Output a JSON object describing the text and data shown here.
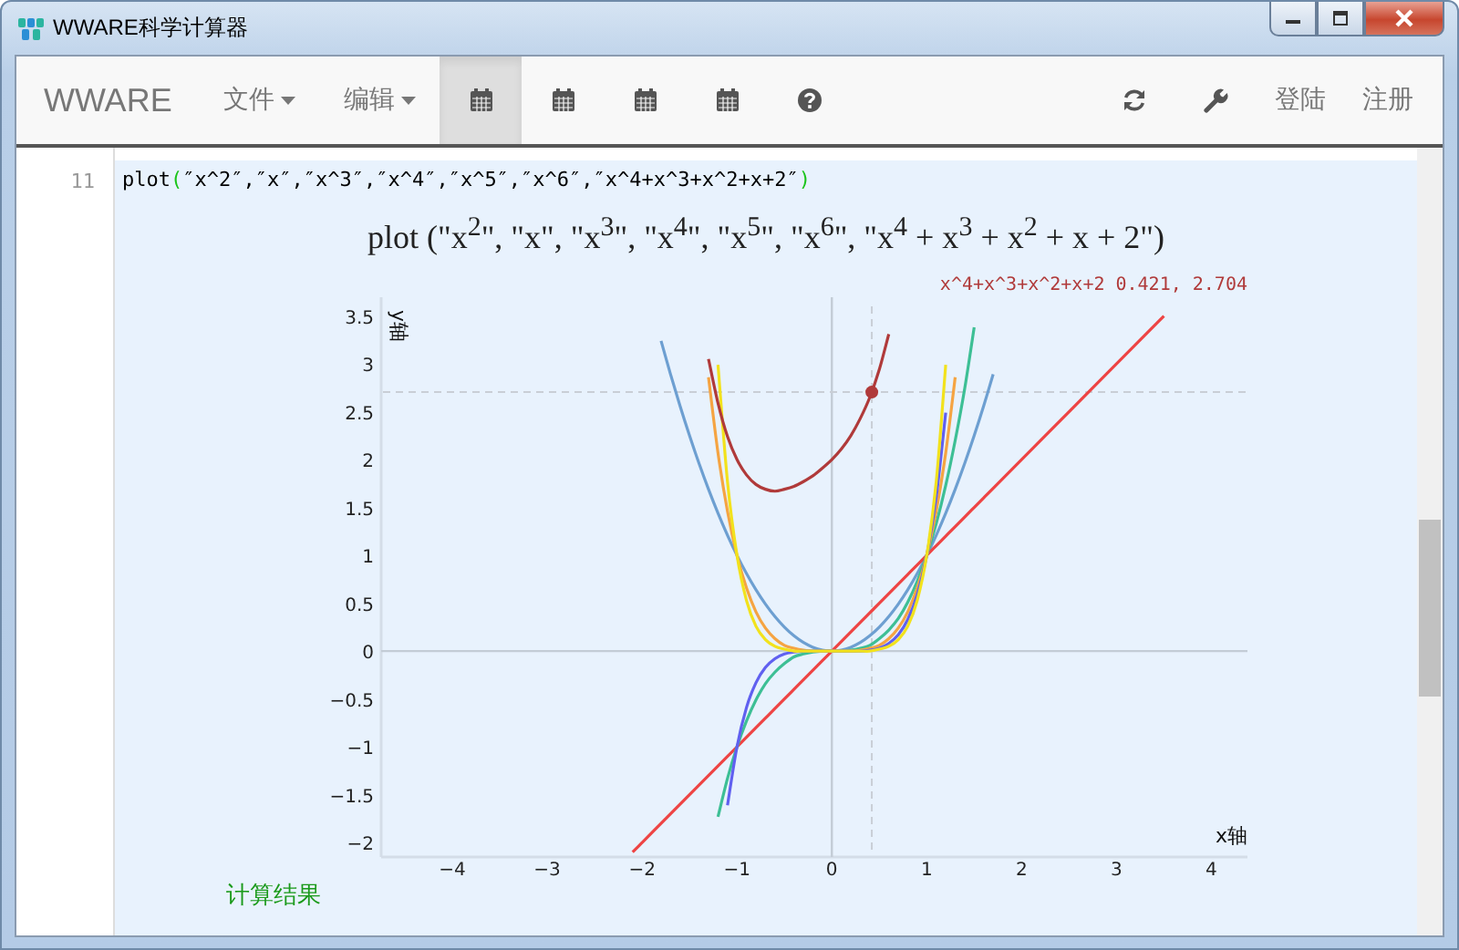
{
  "window": {
    "title": "WWARE科学计算器"
  },
  "navbar": {
    "brand": "WWARE",
    "menus": [
      {
        "label": "文件",
        "dropdown": true
      },
      {
        "label": "编辑",
        "dropdown": true
      }
    ],
    "tools": [
      {
        "kind": "calendar",
        "selected": true
      },
      {
        "kind": "calendar",
        "selected": false
      },
      {
        "kind": "calendar",
        "selected": false
      },
      {
        "kind": "calendar",
        "selected": false
      },
      {
        "kind": "help",
        "selected": false
      }
    ],
    "right_tools": [
      {
        "kind": "refresh"
      },
      {
        "kind": "wrench"
      }
    ],
    "links": [
      "登陆",
      "注册"
    ]
  },
  "editor": {
    "line_number": "11",
    "code": {
      "function": "plot",
      "open": "(",
      "args": "″x^2″,″x″,″x^3″,″x^4″,″x^5″,″x^6″,″x^4+x^3+x^2+x+2″",
      "close": ")"
    },
    "formula": "plot (\"x$^{2}$\", \"x\", \"x$^{3}$\", \"x$^{4}$\", \"x$^{5}$\", \"x$^{6}$\", \"x$^{4}$ + x$^{3}$ + x$^{2}$ + x + 2\")",
    "hover_readout": "x^4+x^3+x^2+x+2 0.421, 2.704",
    "chart_data": {
      "type": "line",
      "xlabel": "x轴",
      "ylabel": "y轴",
      "x": [
        -2.1,
        -2,
        -1.9,
        -1.8,
        -1.7,
        -1.6,
        -1.5,
        -1.4,
        -1.3,
        -1.2,
        -1.1,
        -1,
        -0.9,
        -0.8,
        -0.7,
        -0.6,
        -0.5,
        -0.4,
        -0.3,
        -0.2,
        -0.1,
        0,
        0.1,
        0.2,
        0.3,
        0.4,
        0.5,
        0.6,
        0.7,
        0.8,
        0.9,
        1,
        1.1,
        1.2,
        1.3,
        1.4,
        1.5,
        1.6,
        1.7,
        2.5,
        3.5
      ],
      "series": [
        {
          "color": "#6d9fd1",
          "values": [
            null,
            null,
            null,
            3.24,
            2.89,
            2.56,
            2.25,
            1.96,
            1.69,
            1.44,
            1.21,
            1,
            0.81,
            0.64,
            0.49,
            0.36,
            0.25,
            0.16,
            0.09,
            0.04,
            0.01,
            0,
            0.01,
            0.04,
            0.09,
            0.16,
            0.25,
            0.36,
            0.49,
            0.64,
            0.81,
            1,
            1.21,
            1.44,
            1.69,
            1.96,
            2.25,
            2.56,
            2.89,
            null,
            null
          ]
        },
        {
          "color": "#ee4444",
          "values": [
            -2.1,
            -2,
            -1.9,
            -1.8,
            -1.7,
            -1.6,
            -1.5,
            -1.4,
            -1.3,
            -1.2,
            -1.1,
            -1,
            -0.9,
            -0.8,
            -0.7,
            -0.6,
            -0.5,
            -0.4,
            -0.3,
            -0.2,
            -0.1,
            0,
            0.1,
            0.2,
            0.3,
            0.4,
            0.5,
            0.6,
            0.7,
            0.8,
            0.9,
            1,
            1.1,
            1.2,
            1.3,
            1.4,
            1.5,
            1.6,
            1.7,
            2.5,
            3.5
          ]
        },
        {
          "color": "#3dbf95",
          "values": [
            null,
            null,
            null,
            null,
            null,
            null,
            null,
            null,
            null,
            -1.73,
            -1.33,
            -1,
            -0.73,
            -0.51,
            -0.34,
            -0.22,
            -0.13,
            -0.06,
            -0.03,
            -0.01,
            0,
            0,
            0,
            0.01,
            0.03,
            0.06,
            0.13,
            0.22,
            0.34,
            0.51,
            0.73,
            1,
            1.33,
            1.73,
            2.2,
            2.74,
            3.38,
            null,
            null,
            null,
            null
          ]
        },
        {
          "color": "#f5a442",
          "values": [
            null,
            null,
            null,
            null,
            null,
            null,
            null,
            null,
            2.86,
            2.07,
            1.46,
            1,
            0.66,
            0.41,
            0.24,
            0.13,
            0.06,
            0.03,
            0.01,
            0,
            0,
            0,
            0,
            0,
            0.01,
            0.03,
            0.06,
            0.13,
            0.24,
            0.41,
            0.66,
            1,
            1.46,
            2.07,
            2.86,
            null,
            null,
            null,
            null,
            null,
            null
          ]
        },
        {
          "color": "#6060f0",
          "values": [
            null,
            null,
            null,
            null,
            null,
            null,
            null,
            null,
            null,
            null,
            -1.61,
            -1,
            -0.59,
            -0.33,
            -0.17,
            -0.08,
            -0.03,
            -0.01,
            0,
            0,
            0,
            0,
            0,
            0,
            0,
            0.01,
            0.03,
            0.08,
            0.17,
            0.33,
            0.59,
            1,
            1.61,
            2.49,
            null,
            null,
            null,
            null,
            null,
            null,
            null
          ]
        },
        {
          "color": "#f2e21c",
          "values": [
            null,
            null,
            null,
            null,
            null,
            null,
            null,
            null,
            null,
            2.99,
            1.77,
            1,
            0.53,
            0.26,
            0.12,
            0.05,
            0.02,
            0,
            0,
            0,
            0,
            0,
            0,
            0,
            0,
            0,
            0.02,
            0.05,
            0.12,
            0.26,
            0.53,
            1,
            1.77,
            2.99,
            null,
            null,
            null,
            null,
            null,
            null,
            null
          ]
        },
        {
          "color": "#b03a3a",
          "values": [
            null,
            null,
            null,
            null,
            null,
            null,
            null,
            null,
            3.05,
            2.59,
            2.24,
            2,
            1.84,
            1.74,
            1.69,
            1.67,
            1.69,
            1.72,
            1.77,
            1.83,
            1.91,
            2,
            2.11,
            2.25,
            2.43,
            2.65,
            2.94,
            3.31,
            null,
            null,
            null,
            null,
            null,
            null,
            null,
            null,
            null,
            null,
            null,
            null,
            null
          ]
        }
      ],
      "xlim": [
        -4.75,
        4.38
      ],
      "ylim": [
        -2.15,
        3.6
      ],
      "xticks": [
        -4,
        -3,
        -2,
        -1,
        0,
        1,
        2,
        3,
        4
      ],
      "yticks": [
        -2,
        -1.5,
        -1,
        -0.5,
        0,
        0.5,
        1,
        1.5,
        2,
        2.5,
        3,
        3.5
      ],
      "ref_lines": [
        {
          "axis": "x",
          "value": 0.421
        },
        {
          "axis": "y",
          "value": 2.704
        }
      ]
    },
    "result_label": "计算结果"
  }
}
